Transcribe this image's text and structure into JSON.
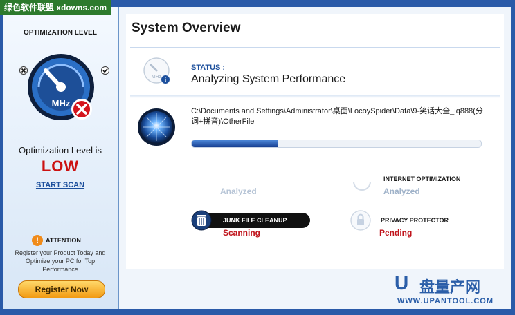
{
  "watermark_top": "绿色软件联盟 xdowns.com",
  "sidebar": {
    "title": "OPTIMIZATION LEVEL",
    "gauge_unit": "MHz",
    "level_label": "Optimization Level is",
    "level_value": "LOW",
    "start_scan": "START SCAN",
    "attention_title": "ATTENTION",
    "attention_text": "Register your Product Today and Optimize your PC for Top Performance",
    "register_button": "Register Now"
  },
  "main": {
    "title": "System Overview",
    "status_label": "STATUS :",
    "status_value": "Analyzing System Performance",
    "status_icon_unit": "MHz",
    "current_path": "C:\\Documents and Settings\\Administrator\\桌面\\LocoySpider\\Data\\9-笑话大全_iq888(分词+拼音)\\OtherFile",
    "progress_fraction": 0.3,
    "tasks": [
      {
        "name": "",
        "status": "Analyzed",
        "status_color": "#b6c4d6"
      },
      {
        "name": "INTERNET OPTIMIZATION",
        "status": "Analyzed",
        "status_color": "#9fb2c9"
      },
      {
        "name": "JUNK FILE CLEANUP",
        "status": "Scanning",
        "status_color": "#c0141c"
      },
      {
        "name": "PRIVACY PROTECTOR",
        "status": "Pending",
        "status_color": "#c0141c"
      }
    ]
  },
  "watermark_bottom": {
    "logo": "U",
    "cn": "盘量产网",
    "url": "WWW.UPANTOOL.COM"
  }
}
